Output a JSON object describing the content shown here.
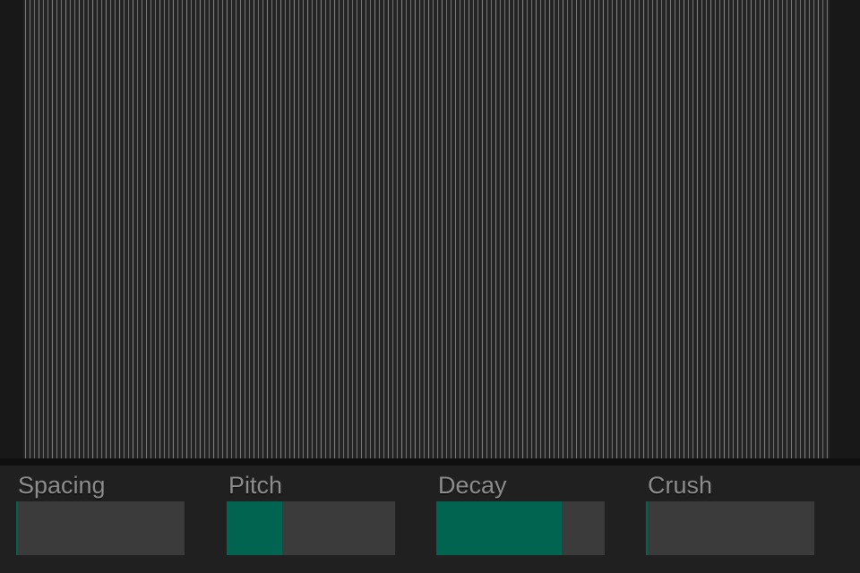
{
  "colors": {
    "background": "#151515",
    "string_field": "#242424",
    "string_line": "#8a8a8a",
    "panel": "#202020",
    "slider_track": "#3b3b3b",
    "slider_fill": "#006450",
    "label_text": "#8e8e8e"
  },
  "controls": [
    {
      "label": "Spacing",
      "value": 0.01
    },
    {
      "label": "Pitch",
      "value": 0.33
    },
    {
      "label": "Decay",
      "value": 0.745
    },
    {
      "label": "Crush",
      "value": 0.01
    }
  ]
}
